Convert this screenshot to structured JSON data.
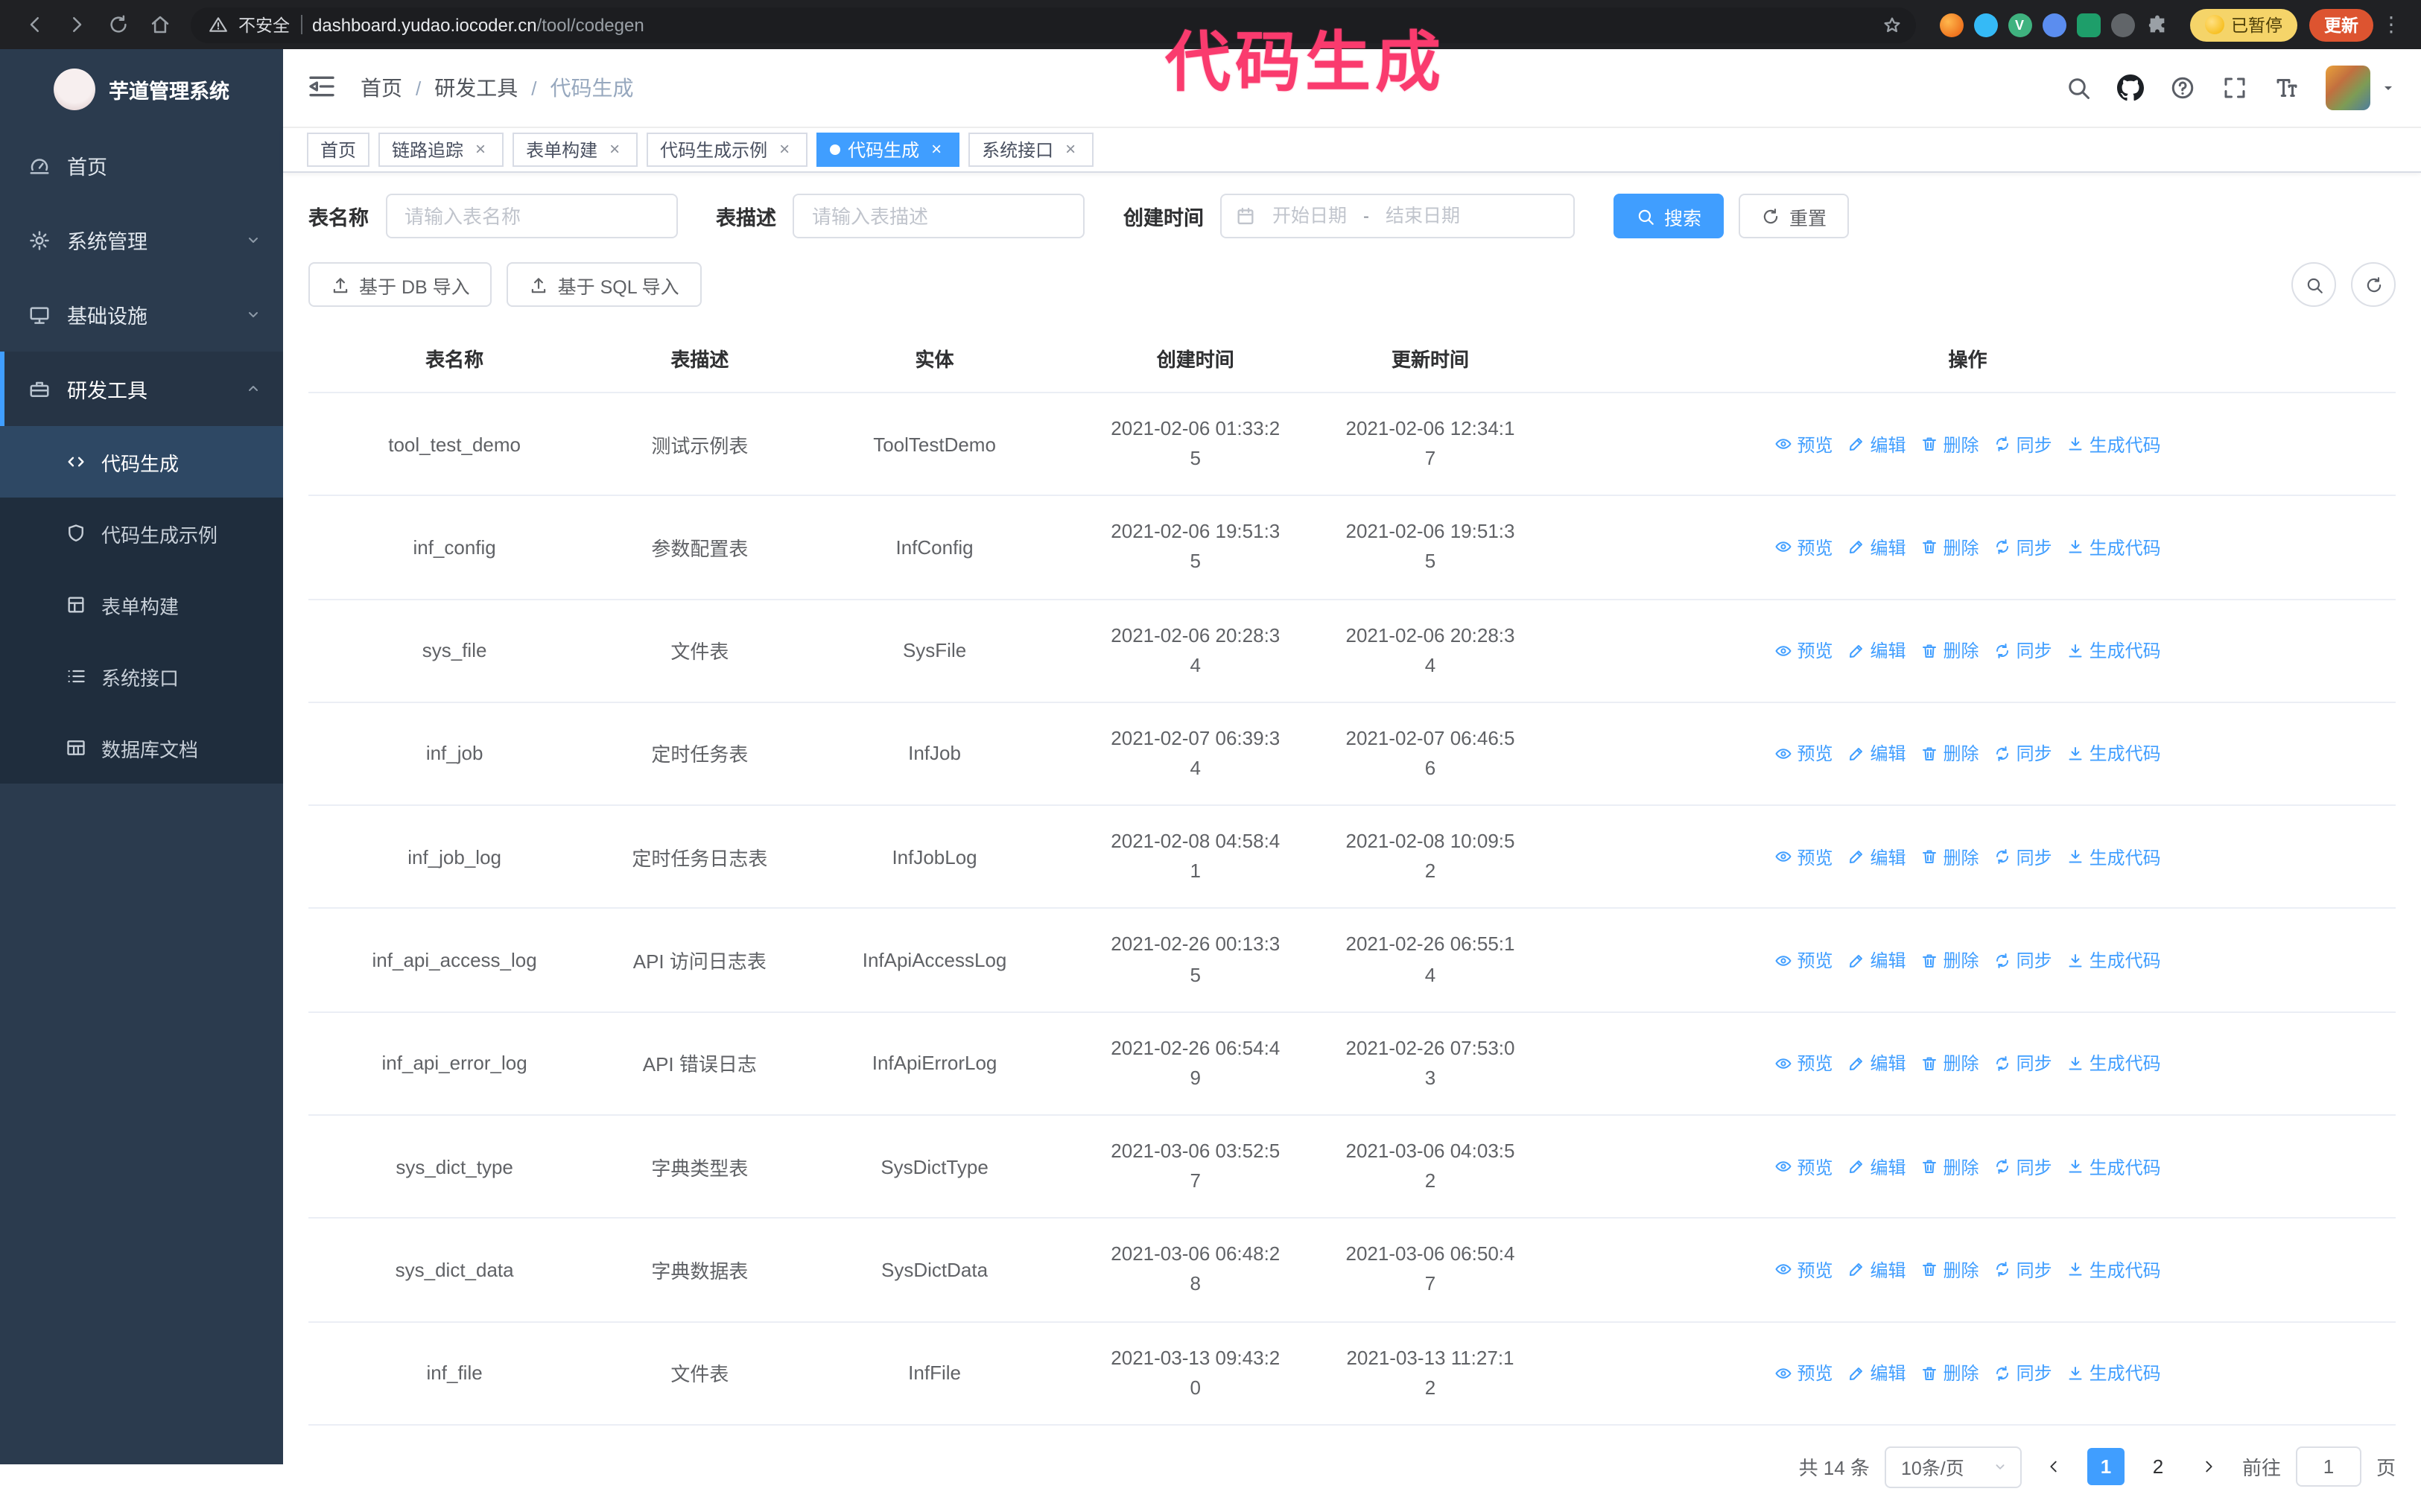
{
  "theme": {
    "primary": "#409eff",
    "annotation_color": "#fa3b6e",
    "sidebar_bg": "#2b3b4e",
    "submenu_bg": "#1f2d3d"
  },
  "annotation": "代码生成",
  "browser": {
    "security_text": "不安全",
    "url_host": "dashboard.yudao.iocoder.cn",
    "url_path": "/tool/codegen",
    "paused_label": "已暂停",
    "update_label": "更新"
  },
  "sidebar": {
    "title": "芋道管理系统",
    "items": [
      {
        "label": "首页"
      },
      {
        "label": "系统管理"
      },
      {
        "label": "基础设施"
      },
      {
        "label": "研发工具"
      }
    ],
    "sub": [
      {
        "label": "代码生成"
      },
      {
        "label": "代码生成示例"
      },
      {
        "label": "表单构建"
      },
      {
        "label": "系统接口"
      },
      {
        "label": "数据库文档"
      }
    ]
  },
  "breadcrumb": {
    "items": [
      "首页",
      "研发工具",
      "代码生成"
    ],
    "separator": "/"
  },
  "tabs": [
    {
      "label": "首页"
    },
    {
      "label": "链路追踪"
    },
    {
      "label": "表单构建"
    },
    {
      "label": "代码生成示例"
    },
    {
      "label": "代码生成"
    },
    {
      "label": "系统接口"
    }
  ],
  "filters": {
    "table_name_label": "表名称",
    "table_name_placeholder": "请输入表名称",
    "table_desc_label": "表描述",
    "table_desc_placeholder": "请输入表描述",
    "create_time_label": "创建时间",
    "date_start_placeholder": "开始日期",
    "date_separator": "-",
    "date_end_placeholder": "结束日期",
    "search_label": "搜索",
    "reset_label": "重置"
  },
  "toolbar": {
    "import_db_label": "基于 DB 导入",
    "import_sql_label": "基于 SQL 导入"
  },
  "table": {
    "columns": [
      "表名称",
      "表描述",
      "实体",
      "创建时间",
      "更新时间",
      "操作"
    ],
    "actions": [
      "预览",
      "编辑",
      "删除",
      "同步",
      "生成代码"
    ],
    "rows": [
      {
        "name": "tool_test_demo",
        "desc": "测试示例表",
        "entity": "ToolTestDemo",
        "created": "2021-02-06 01:33:25",
        "updated": "2021-02-06 12:34:17"
      },
      {
        "name": "inf_config",
        "desc": "参数配置表",
        "entity": "InfConfig",
        "created": "2021-02-06 19:51:35",
        "updated": "2021-02-06 19:51:35"
      },
      {
        "name": "sys_file",
        "desc": "文件表",
        "entity": "SysFile",
        "created": "2021-02-06 20:28:34",
        "updated": "2021-02-06 20:28:34"
      },
      {
        "name": "inf_job",
        "desc": "定时任务表",
        "entity": "InfJob",
        "created": "2021-02-07 06:39:34",
        "updated": "2021-02-07 06:46:56"
      },
      {
        "name": "inf_job_log",
        "desc": "定时任务日志表",
        "entity": "InfJobLog",
        "created": "2021-02-08 04:58:41",
        "updated": "2021-02-08 10:09:52"
      },
      {
        "name": "inf_api_access_log",
        "desc": "API 访问日志表",
        "entity": "InfApiAccessLog",
        "created": "2021-02-26 00:13:35",
        "updated": "2021-02-26 06:55:14"
      },
      {
        "name": "inf_api_error_log",
        "desc": "API 错误日志",
        "entity": "InfApiErrorLog",
        "created": "2021-02-26 06:54:49",
        "updated": "2021-02-26 07:53:03"
      },
      {
        "name": "sys_dict_type",
        "desc": "字典类型表",
        "entity": "SysDictType",
        "created": "2021-03-06 03:52:57",
        "updated": "2021-03-06 04:03:52"
      },
      {
        "name": "sys_dict_data",
        "desc": "字典数据表",
        "entity": "SysDictData",
        "created": "2021-03-06 06:48:28",
        "updated": "2021-03-06 06:50:47"
      },
      {
        "name": "inf_file",
        "desc": "文件表",
        "entity": "InfFile",
        "created": "2021-03-13 09:43:20",
        "updated": "2021-03-13 11:27:12"
      }
    ]
  },
  "pagination": {
    "total_label": "共 14 条",
    "page_size_label": "10条/页",
    "pages": [
      "1",
      "2"
    ],
    "goto_label": "前往",
    "goto_value": "1",
    "goto_suffix": "页"
  }
}
